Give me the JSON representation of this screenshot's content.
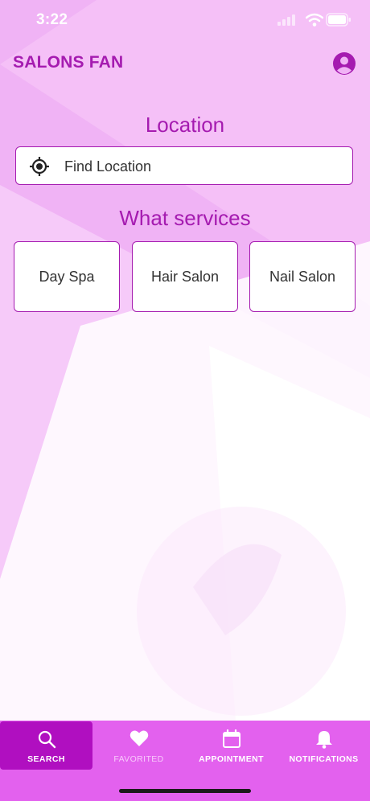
{
  "status_bar": {
    "time": "3:22"
  },
  "header": {
    "title": "SALONS FAN",
    "profile_icon": "account-circle-icon"
  },
  "location": {
    "heading": "Location",
    "button_label": "Find Location",
    "icon": "gps-target-icon"
  },
  "services": {
    "heading": "What services",
    "items": [
      {
        "label": "Day Spa"
      },
      {
        "label": "Hair Salon"
      },
      {
        "label": "Nail Salon"
      }
    ]
  },
  "tabs": [
    {
      "label": "SEARCH",
      "icon": "search-icon",
      "active": true
    },
    {
      "label": "FAVORITED",
      "icon": "heart-icon",
      "active": false
    },
    {
      "label": "APPOINTMENT",
      "icon": "calendar-icon",
      "active": false
    },
    {
      "label": "NOTIFICATIONS",
      "icon": "bell-icon",
      "active": false
    }
  ],
  "colors": {
    "accent": "#a51bb0",
    "tabbar": "#e361ee",
    "tab_active": "#b00fc0",
    "background": "#f0b3f5"
  }
}
